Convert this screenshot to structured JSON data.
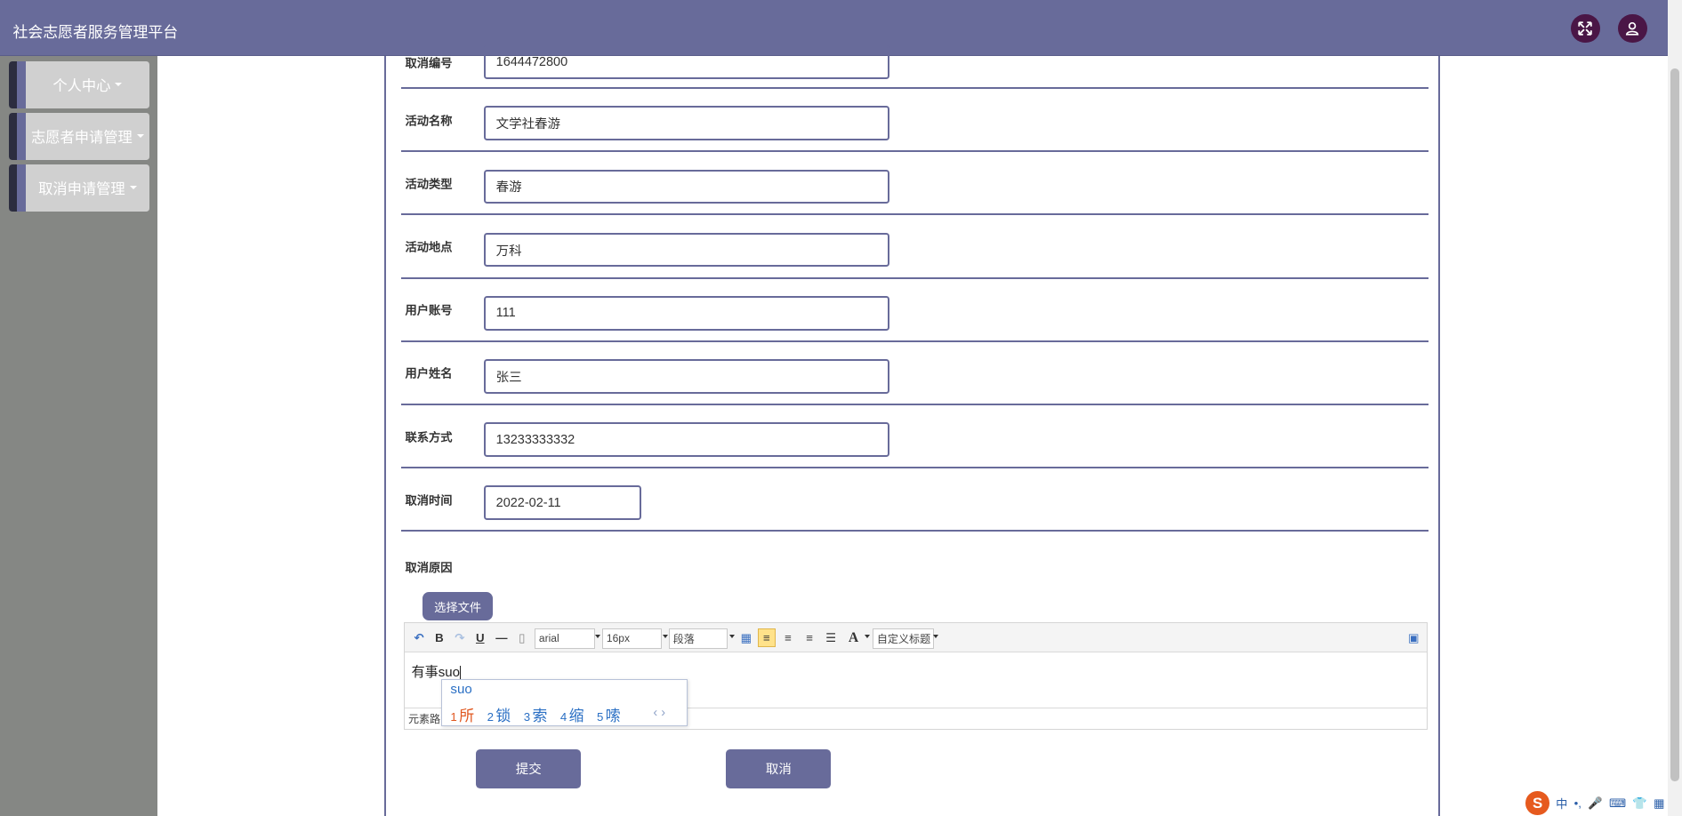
{
  "header": {
    "title": "社会志愿者服务管理平台",
    "colors": {
      "bar": "#686b9a",
      "button": "#4a1646"
    }
  },
  "sidebar": {
    "items": [
      {
        "label": "个人中心"
      },
      {
        "label": "志愿者申请管理"
      },
      {
        "label": "取消申请管理"
      }
    ]
  },
  "form": {
    "fields": [
      {
        "label": "取消编号",
        "value": "1644472800"
      },
      {
        "label": "活动名称",
        "value": "文学社春游"
      },
      {
        "label": "活动类型",
        "value": "春游"
      },
      {
        "label": "活动地点",
        "value": "万科"
      },
      {
        "label": "用户账号",
        "value": "111"
      },
      {
        "label": "用户姓名",
        "value": "张三"
      },
      {
        "label": "联系方式",
        "value": "13233333332"
      },
      {
        "label": "取消时间",
        "value": "2022-02-11"
      }
    ],
    "reason_label": "取消原因",
    "file_button": "选择文件",
    "editor": {
      "toolbar": {
        "bold": "B",
        "underline": "U",
        "font_family": "arial",
        "font_size": "16px",
        "paragraph": "段落",
        "font_color": "A",
        "custom_title": "自定义标题"
      },
      "content": "有事suo",
      "path_label": "元素路"
    },
    "ime": {
      "input": "suo",
      "candidates": [
        {
          "num": "1",
          "text": "所"
        },
        {
          "num": "2",
          "text": "锁"
        },
        {
          "num": "3",
          "text": "索"
        },
        {
          "num": "4",
          "text": "缩"
        },
        {
          "num": "5",
          "text": "嗦"
        }
      ],
      "nav": "‹ ›"
    },
    "submit_label": "提交",
    "cancel_label": "取消"
  },
  "tray": {
    "lang": "中",
    "punct": "•,"
  }
}
